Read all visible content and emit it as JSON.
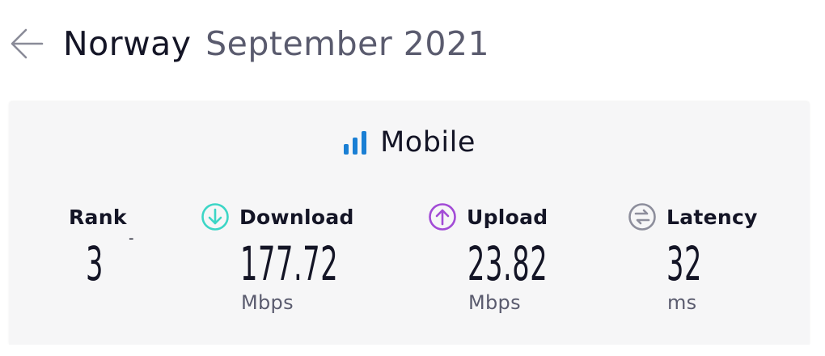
{
  "header": {
    "country": "Norway",
    "period": "September 2021"
  },
  "card": {
    "title": "Mobile",
    "icon": "signal-bars-icon",
    "accent_color": "#1a7fd4"
  },
  "metrics": {
    "rank": {
      "label": "Rank",
      "value": "3",
      "change": "-"
    },
    "download": {
      "label": "Download",
      "value": "177.72",
      "unit": "Mbps",
      "icon": "arrow-down-circle-icon",
      "color": "#3cd6c6"
    },
    "upload": {
      "label": "Upload",
      "value": "23.82",
      "unit": "Mbps",
      "icon": "arrow-up-circle-icon",
      "color": "#a24bd6"
    },
    "latency": {
      "label": "Latency",
      "value": "32",
      "unit": "ms",
      "icon": "latency-circle-icon",
      "color": "#8d8e9c"
    }
  }
}
